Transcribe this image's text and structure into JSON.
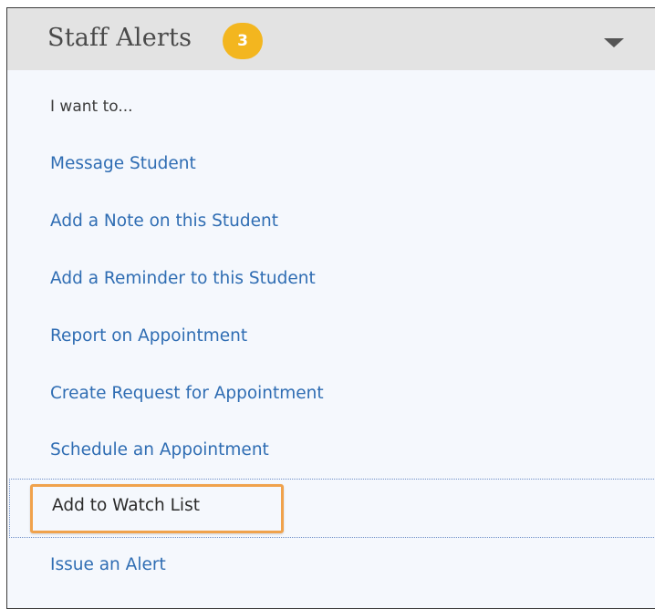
{
  "header": {
    "title": "Staff Alerts",
    "badge_count": "3"
  },
  "menu": {
    "subheader": "I want to...",
    "items": [
      {
        "label": "Message Student"
      },
      {
        "label": "Add a Note on this Student"
      },
      {
        "label": "Add a Reminder to this Student"
      },
      {
        "label": "Report on Appointment"
      },
      {
        "label": "Create Request for Appointment"
      },
      {
        "label": "Schedule an Appointment"
      },
      {
        "label": "Add to Watch List"
      },
      {
        "label": "Issue an Alert"
      }
    ]
  },
  "colors": {
    "header_bg": "#e3e3e3",
    "badge": "#f3b61f",
    "link": "#2f6db3",
    "highlight": "#f0a24c",
    "panel_bg": "#f5f8fd"
  },
  "icons": {
    "expand": "chevron-down-icon"
  }
}
